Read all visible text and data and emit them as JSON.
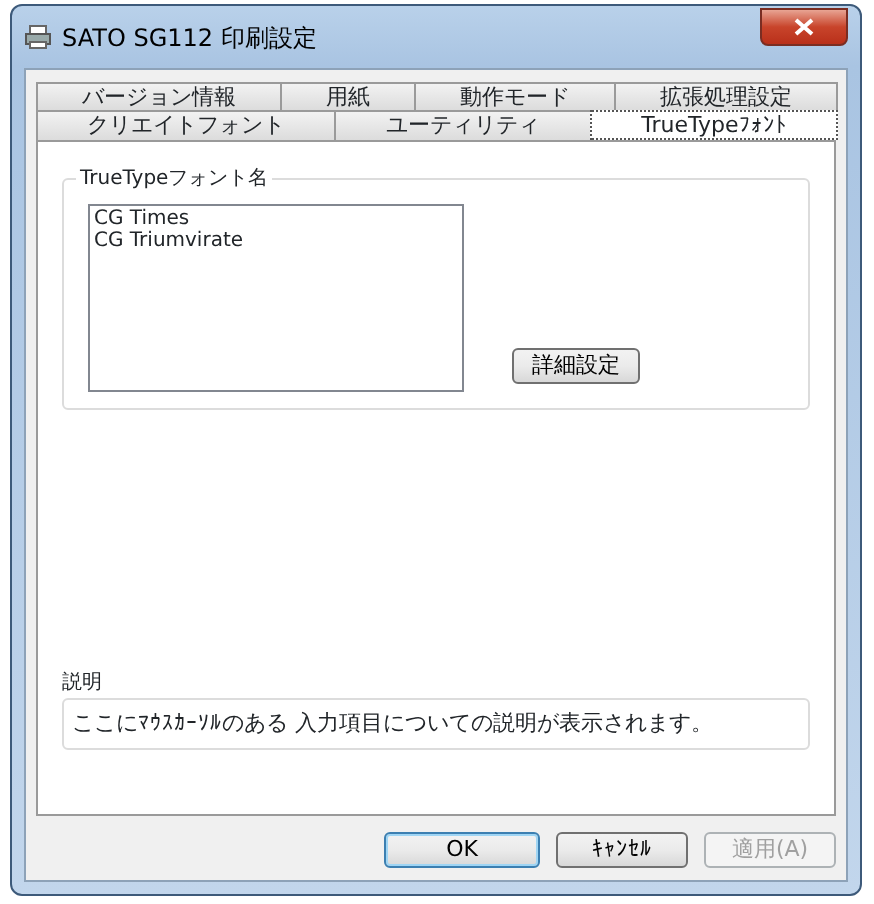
{
  "window": {
    "title": "SATO SG112 印刷設定"
  },
  "tab_rows": [
    [
      {
        "label": "バージョン情報",
        "selected": false
      },
      {
        "label": "用紙",
        "selected": false
      },
      {
        "label": "動作モード",
        "selected": false
      },
      {
        "label": "拡張処理設定",
        "selected": false
      }
    ],
    [
      {
        "label": "クリエイトフォント",
        "selected": false
      },
      {
        "label": "ユーティリティ",
        "selected": false
      },
      {
        "label": "TrueTypeﾌｫﾝﾄ",
        "selected": true
      }
    ]
  ],
  "font_group": {
    "label": "TrueTypeフォント名",
    "fonts": [
      "CG Times",
      "CG Triumvirate"
    ],
    "detail_button": "詳細設定"
  },
  "description": {
    "label": "説明",
    "text": "ここにﾏｳｽｶｰｿﾙのある 入力項目についての説明が表示されます。"
  },
  "buttons": [
    {
      "label": "OK",
      "kind": "default",
      "disabled": false
    },
    {
      "label": "ｷｬﾝｾﾙ",
      "kind": "normal",
      "disabled": false
    },
    {
      "label": "適用(A)",
      "kind": "normal",
      "disabled": true
    }
  ]
}
